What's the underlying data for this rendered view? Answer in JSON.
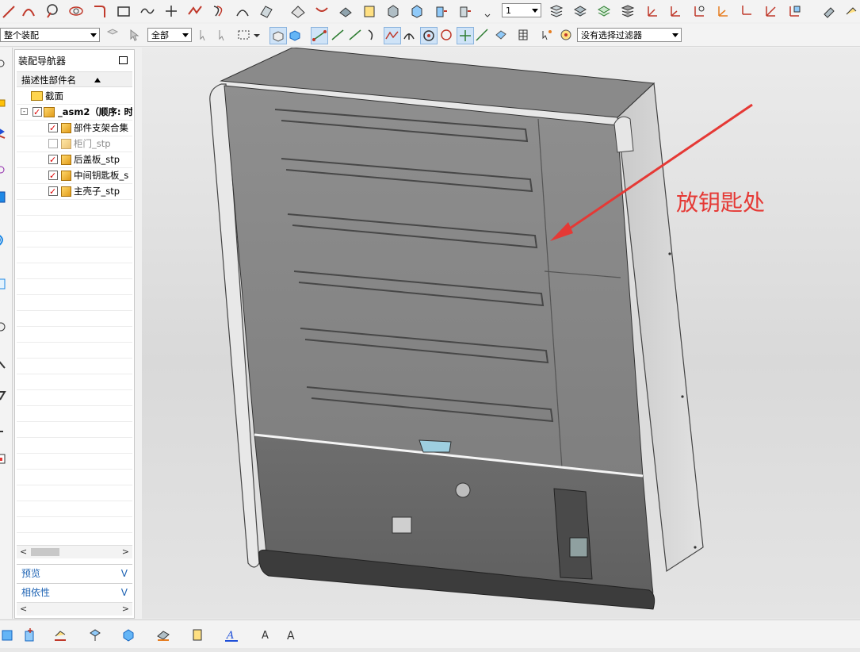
{
  "toolbar": {
    "layer_value": "1",
    "scope_value": "整个装配",
    "filter_value": "全部",
    "selection_filter": "没有选择过滤器"
  },
  "navigator": {
    "title": "装配导航器",
    "column_header": "描述性部件名",
    "items": [
      {
        "label": "截面",
        "checked": null,
        "type": "folder"
      },
      {
        "label": "_asm2（顺序: 时",
        "checked": true,
        "type": "assembly"
      },
      {
        "label": "部件支架合集",
        "checked": true,
        "type": "part"
      },
      {
        "label": "柜门_stp",
        "checked": false,
        "type": "part"
      },
      {
        "label": "后盖板_stp",
        "checked": true,
        "type": "part"
      },
      {
        "label": "中间钥匙板_s",
        "checked": true,
        "type": "part"
      },
      {
        "label": "主壳子_stp",
        "checked": true,
        "type": "part"
      }
    ],
    "preview_label": "预览",
    "dependency_label": "相依性"
  },
  "viewport": {
    "annotation_text": "放钥匙处",
    "annotation_color": "#e53935"
  }
}
